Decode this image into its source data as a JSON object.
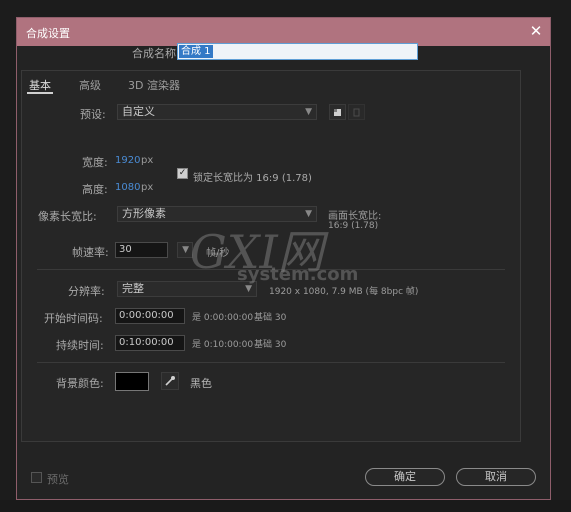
{
  "dialog": {
    "title": "合成设置",
    "close_glyph": "✕"
  },
  "name": {
    "label": "合成名称:",
    "value": "合成 1"
  },
  "tabs": [
    {
      "label": "基本"
    },
    {
      "label": "高级"
    },
    {
      "label": "3D 渲染器"
    }
  ],
  "preset": {
    "label": "预设:",
    "value": "自定义"
  },
  "width": {
    "label": "宽度:",
    "value": "1920",
    "unit": "px"
  },
  "height": {
    "label": "高度:",
    "value": "1080",
    "unit": "px"
  },
  "lock_aspect": {
    "label": "锁定长宽比为 16:9 (1.78)",
    "checked": true
  },
  "pixel_aspect": {
    "label": "像素长宽比:",
    "value": "方形像素"
  },
  "frame_aspect": {
    "label": "画面长宽比:",
    "value": "16:9 (1.78)"
  },
  "frame_rate": {
    "label": "帧速率:",
    "value": "30",
    "unit": "帧/秒"
  },
  "resolution": {
    "label": "分辨率:",
    "value": "完整",
    "info": "1920 x 1080, 7.9 MB (每 8bpc 帧)"
  },
  "start_timecode": {
    "label": "开始时间码:",
    "value": "0:00:00:00",
    "info": "是 0:00:00:00",
    "base": "基础 30"
  },
  "duration": {
    "label": "持续时间:",
    "value": "0:10:00:00",
    "info": "是 0:10:00:00",
    "base": "基础 30"
  },
  "background": {
    "label": "背景颜色:",
    "color": "#000000",
    "color_name": "黑色"
  },
  "preview": {
    "label": "预览"
  },
  "buttons": {
    "ok": "确定",
    "cancel": "取消"
  },
  "watermark": {
    "logo": "GXI网",
    "site": "system.com"
  },
  "colors": {
    "titlebar": "#b0737f",
    "accent_blue": "#4a8bd3",
    "selection": "#3379c6"
  },
  "icons": {
    "close": "close-icon",
    "new_preset": "new-preset-icon",
    "delete_preset": "delete-icon",
    "eyedropper": "eyedropper-icon",
    "dropdown": "chevron-down-icon"
  }
}
